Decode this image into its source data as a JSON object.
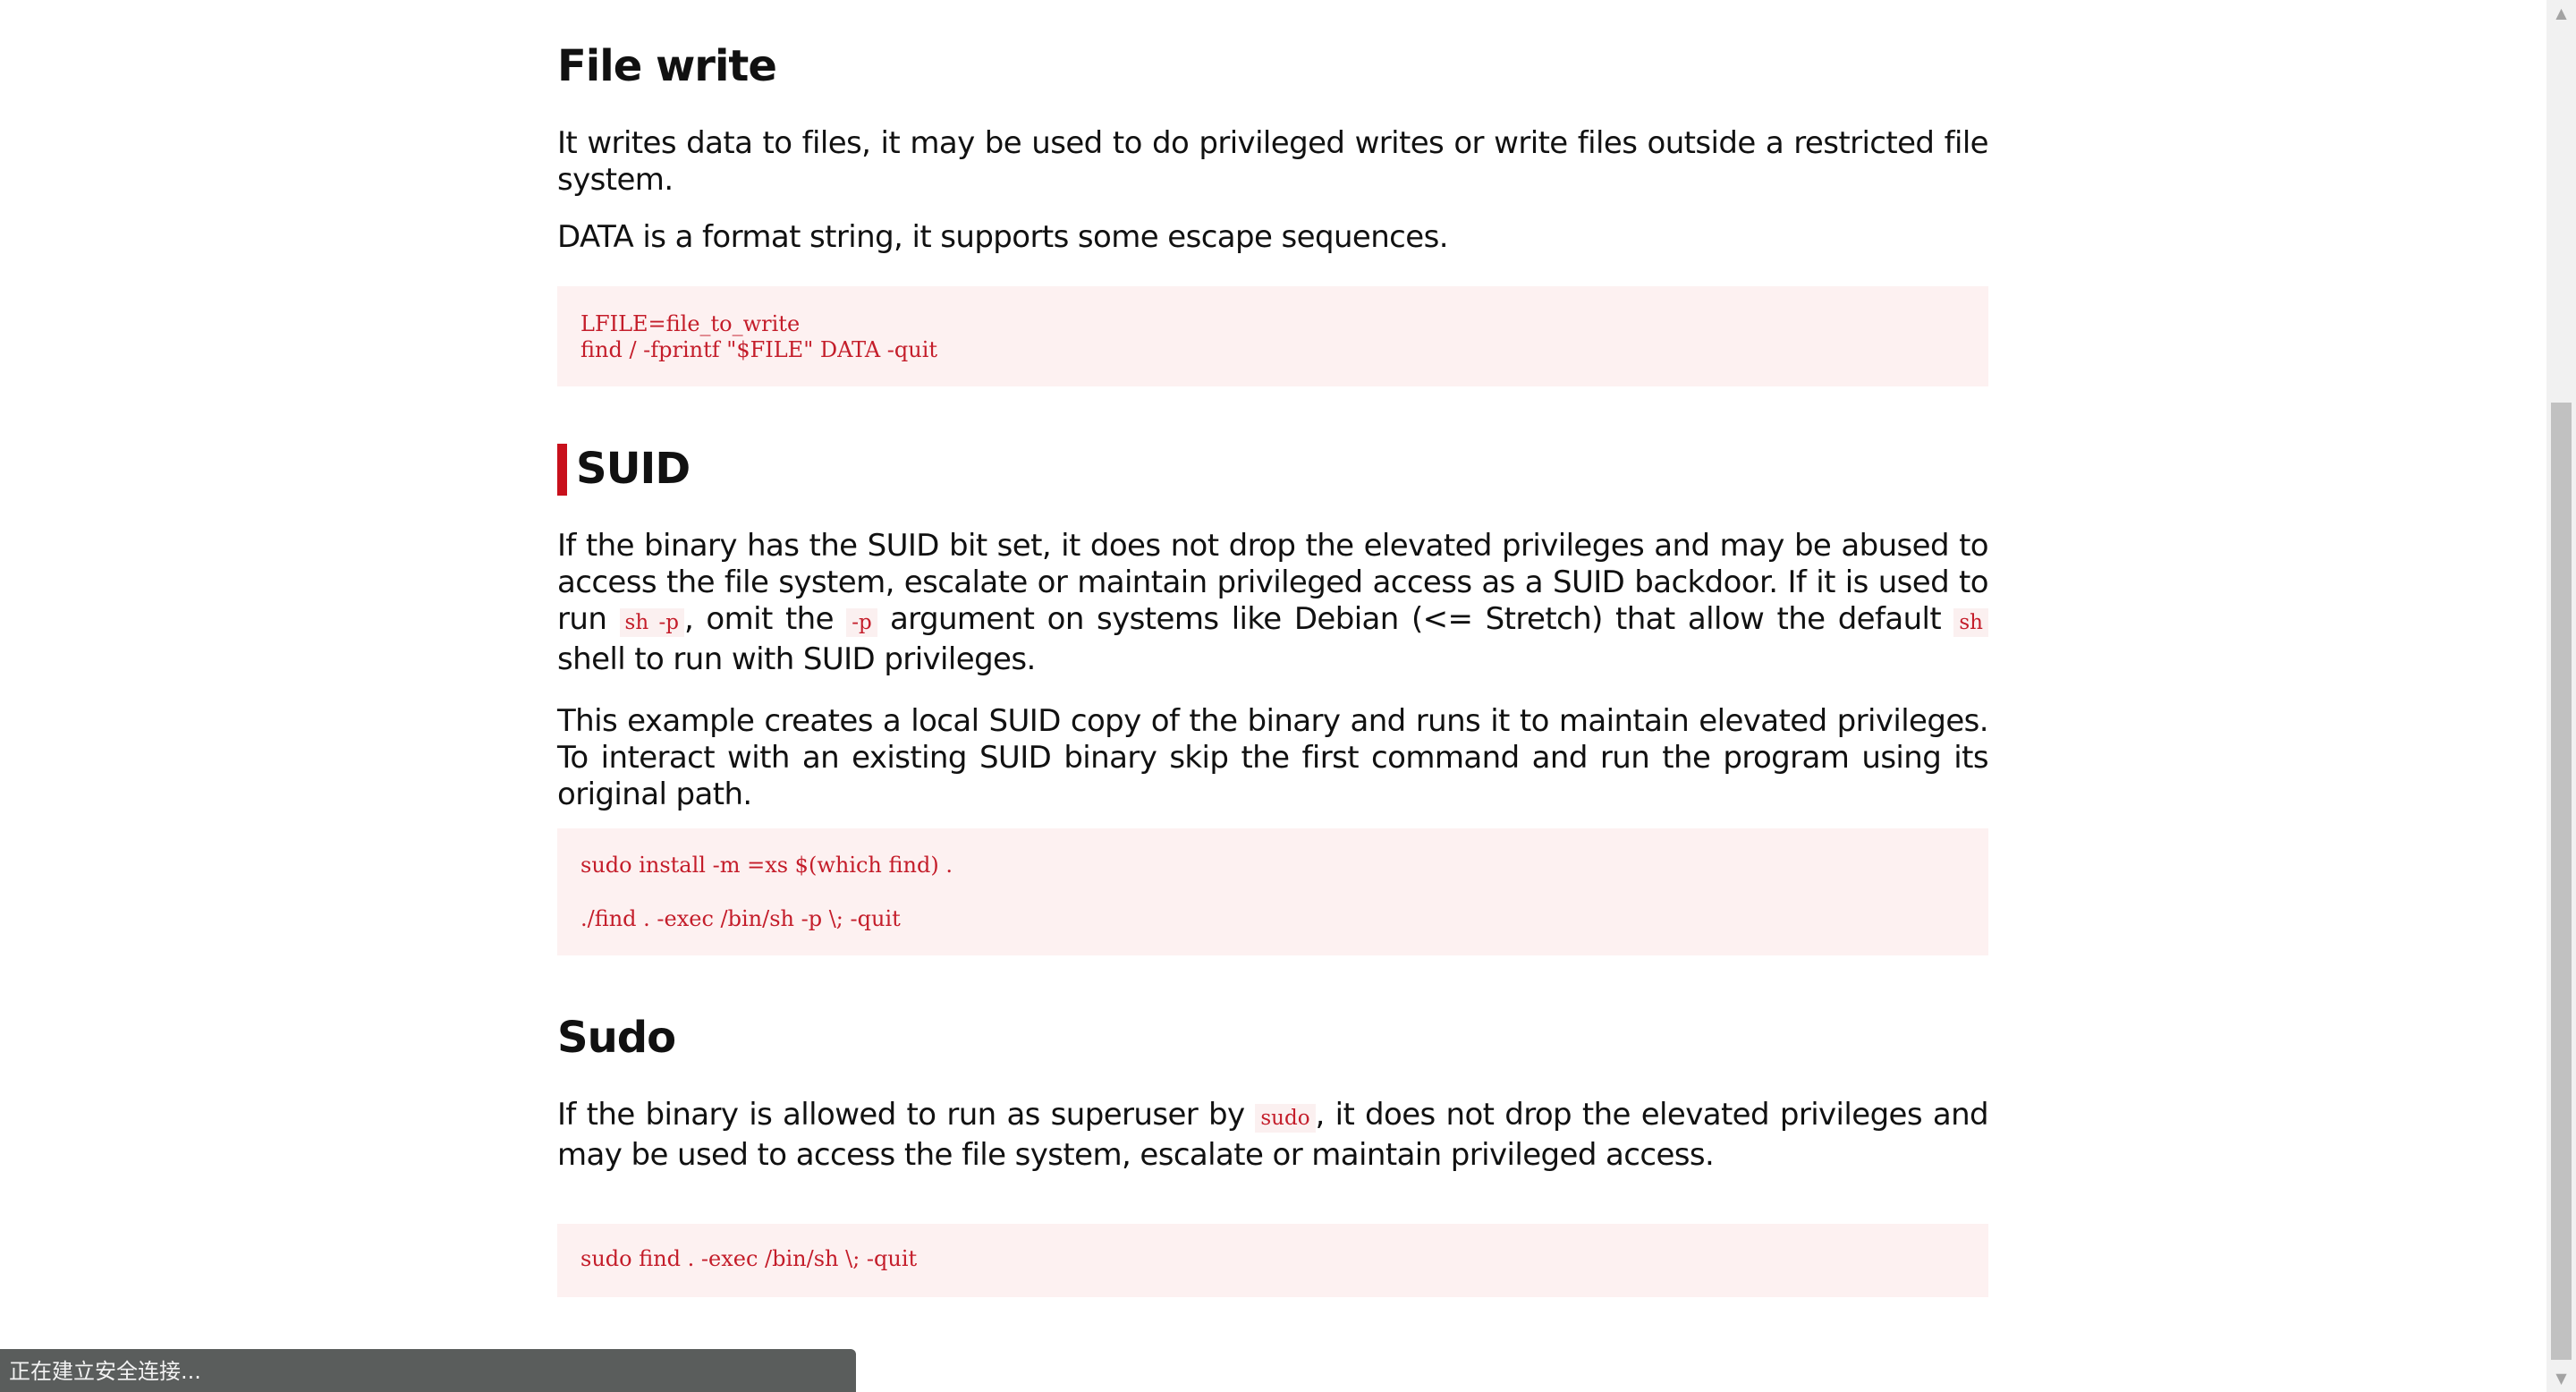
{
  "sections": {
    "file_write": {
      "heading": "File write",
      "description": "It writes data to files, it may be used to do privileged writes or write files outside a restricted file system.",
      "note": "DATA is a format string, it supports some escape sequences.",
      "code_lines": [
        "LFILE=file_to_write",
        "find / -fprintf \"$FILE\" DATA -quit"
      ]
    },
    "suid": {
      "heading": "SUID",
      "p1_part1": "If the binary has the SUID bit set, it does not drop the elevated privileges and may be abused to access the file system, escalate or maintain privileged access as a SUID backdoor. If it is used to run ",
      "p1_code1": "sh -p",
      "p1_part2": ", omit the ",
      "p1_code2": "-p",
      "p1_part3": " argument on systems like Debian (<= Stretch) that allow the default ",
      "p1_code3": "sh",
      "p1_part4": " shell to run with SUID privileges.",
      "p2": "This example creates a local SUID copy of the binary and runs it to maintain elevated privileges. To interact with an existing SUID binary skip the first command and run the program using its original path.",
      "code_lines": [
        "sudo install -m =xs $(which find) .",
        "./find . -exec /bin/sh -p \\; -quit"
      ]
    },
    "sudo": {
      "heading": "Sudo",
      "p_part1": "If the binary is allowed to run as superuser by ",
      "p_code": "sudo",
      "p_part2": ", it does not drop the elevated privileges and may be used to access the file system, escalate or maintain privileged access.",
      "code_lines": [
        "sudo find . -exec /bin/sh \\; -quit"
      ]
    }
  },
  "status_bar": {
    "text": "正在建立安全连接..."
  },
  "scrollbar": {
    "up_icon": "triangle-up",
    "down_icon": "triangle-down"
  }
}
